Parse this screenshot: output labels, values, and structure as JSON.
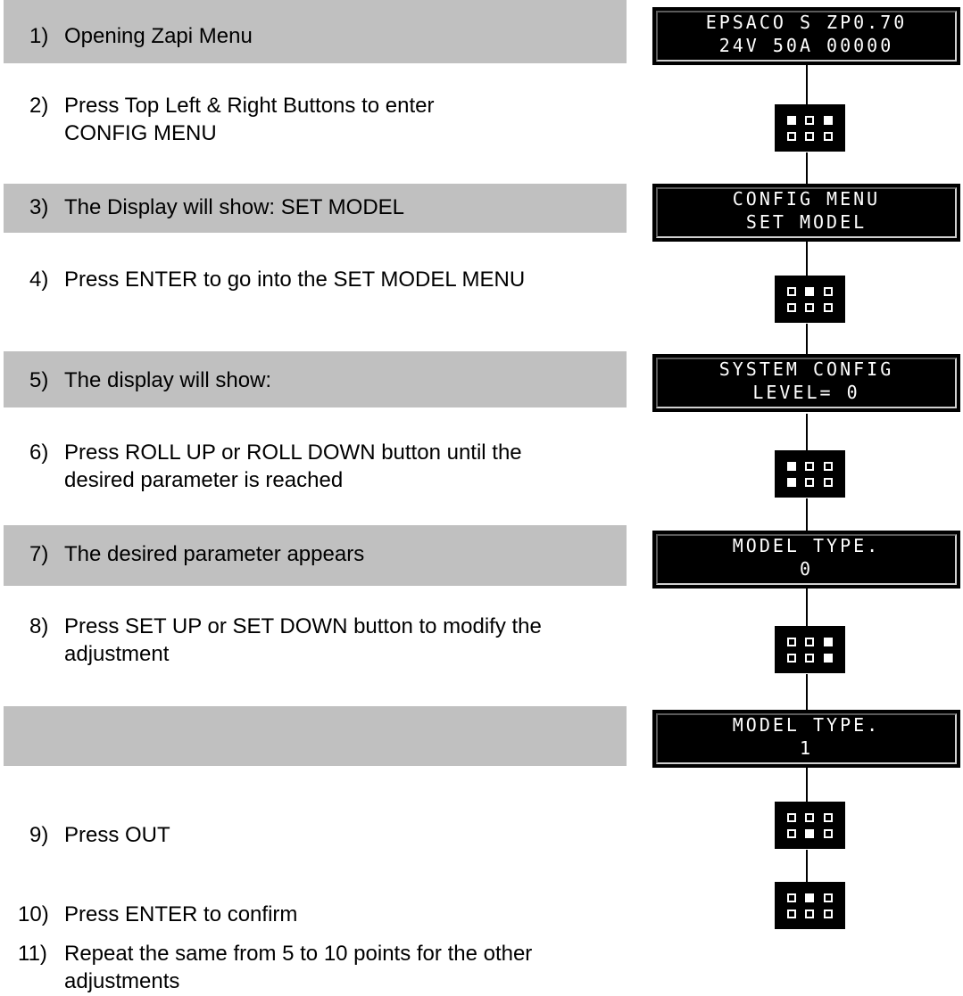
{
  "steps": [
    {
      "num": "1)",
      "text": "Opening Zapi Menu"
    },
    {
      "num": "2)",
      "text": "Press Top Left & Right Buttons to enter CONFIG MENU"
    },
    {
      "num": "3)",
      "text": "The Display will show: SET MODEL"
    },
    {
      "num": "4)",
      "text": "Press ENTER to go into the SET MODEL MENU"
    },
    {
      "num": "5)",
      "text": "The display will show:"
    },
    {
      "num": "6)",
      "text": "Press ROLL UP or ROLL DOWN button until the desired parameter is reached"
    },
    {
      "num": "7)",
      "text": "The desired parameter appears"
    },
    {
      "num": "8)",
      "text": "Press SET UP or SET DOWN button to modify the adjustment"
    },
    {
      "num": "9)",
      "text": "Press OUT"
    },
    {
      "num": "10)",
      "text": "Press ENTER to confirm"
    },
    {
      "num": "11)",
      "text": "Repeat the same from 5 to 10 points for the other adjustments"
    }
  ],
  "displays": [
    {
      "line1": "EPSACO S ZP0.70",
      "line2": "24V 50A 00000"
    },
    {
      "line1": "CONFIG MENU",
      "line2": "SET MODEL"
    },
    {
      "line1": "SYSTEM CONFIG",
      "line2": "LEVEL= 0"
    },
    {
      "line1": "MODEL TYPE.",
      "line2": "0"
    },
    {
      "line1": "MODEL TYPE.",
      "line2": "1"
    }
  ],
  "keypads": [
    {
      "pressed": [
        [
          true,
          false,
          true
        ],
        [
          false,
          false,
          false
        ]
      ]
    },
    {
      "pressed": [
        [
          false,
          true,
          false
        ],
        [
          false,
          false,
          false
        ]
      ]
    },
    {
      "pressed": [
        [
          true,
          false,
          false
        ],
        [
          true,
          false,
          false
        ]
      ]
    },
    {
      "pressed": [
        [
          false,
          false,
          true
        ],
        [
          false,
          false,
          true
        ]
      ]
    },
    {
      "pressed": [
        [
          false,
          false,
          false
        ],
        [
          false,
          true,
          false
        ]
      ]
    },
    {
      "pressed": [
        [
          false,
          true,
          false
        ],
        [
          false,
          false,
          false
        ]
      ]
    }
  ],
  "colors": {
    "band": "#c0c0c0",
    "lcd_background": "#000000",
    "lcd_text": "#ffffff"
  }
}
